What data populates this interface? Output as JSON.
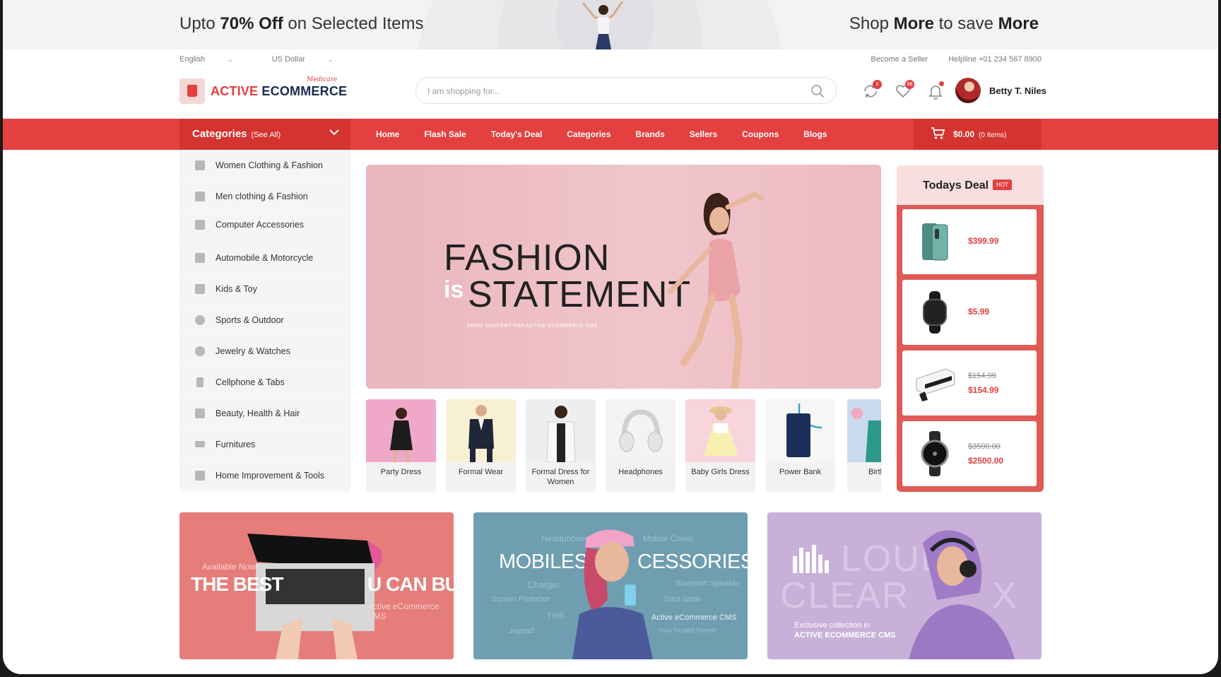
{
  "promo": {
    "left_pre": "Upto ",
    "left_bold": "70% Off",
    "left_post": " on Selected Items",
    "right_pre": "Shop ",
    "right_bold1": "More",
    "right_mid": " to save ",
    "right_bold2": "More"
  },
  "util": {
    "language": "English",
    "currency": "US Dollar",
    "become_seller": "Become a Seller",
    "helpline": "Helpline +01 234 567 8900"
  },
  "logo": {
    "word1": "ACTIVE",
    "word2": "ECOMMERCE",
    "tag": "Medicare"
  },
  "search": {
    "placeholder": "I am shopping for..."
  },
  "header_icons": {
    "compare_count": "0",
    "wishlist_count": "88"
  },
  "user": {
    "name": "Betty T. Niles"
  },
  "nav": {
    "categories_label": "Categories",
    "see_all": "(See All)",
    "links": [
      "Home",
      "Flash Sale",
      "Today's Deal",
      "Categories",
      "Brands",
      "Sellers",
      "Coupons",
      "Blogs"
    ],
    "cart_amount": "$0.00",
    "cart_items": "(0 Items)"
  },
  "sidebar": {
    "items": [
      "Women Clothing & Fashion",
      "Men clothing & Fashion",
      "Computer Accessories",
      "Automobile & Motorcycle",
      "Kids & Toy",
      "Sports & Outdoor",
      "Jewelry & Watches",
      "Cellphone & Tabs",
      "Beauty, Health & Hair",
      "Furnitures",
      "Home Improvement & Tools"
    ]
  },
  "hero": {
    "line1": "FASHION",
    "is": "is",
    "line2": "STATEMENT",
    "demo": "DEMO CONTENT FOR ACTIVE ECOMMERCE CMS"
  },
  "thumbs": [
    "Party Dress",
    "Formal Wear",
    "Formal Dress for Women",
    "Headphones",
    "Baby Girls Dress",
    "Power Bank",
    "Birthda"
  ],
  "deal": {
    "title": "Todays Deal",
    "hot": "HOT",
    "items": [
      {
        "old": "",
        "price": "$399.99"
      },
      {
        "old": "",
        "price": "$5.99"
      },
      {
        "old": "$154.99",
        "price": "$154.99"
      },
      {
        "old": "$3500.00",
        "price": "$2500.00"
      }
    ]
  },
  "banners": {
    "b1": {
      "available": "Available Now",
      "best": "THE BEST",
      "ucanbuy": "U CAN BUY",
      "sub": "Active eCommerce CMS"
    },
    "b2": {
      "title1": "MOBILES &",
      "title2": "CESSORIES",
      "headphones": "Headphones",
      "mobile_cover": "Mobile Cover",
      "charger": "Charger",
      "bluetooth": "Bluetooth Speaker",
      "screen": "Screen Protector",
      "data_cable": "Data cable",
      "tws": "TWS",
      "cms": "Active eCommerce CMS",
      "joypad": "Joypad",
      "partner": "Your Trusted Partner"
    },
    "b3": {
      "loud": "LOUD",
      "clear": "CLEAR",
      "ex": "X",
      "excl": "Exclusive collection in",
      "cms": "ACTIVE ECOMMERCE CMS"
    }
  },
  "colors": {
    "brand_red": "#e3403f",
    "dark_red": "#d4332f",
    "navy": "#1c2c4f"
  }
}
